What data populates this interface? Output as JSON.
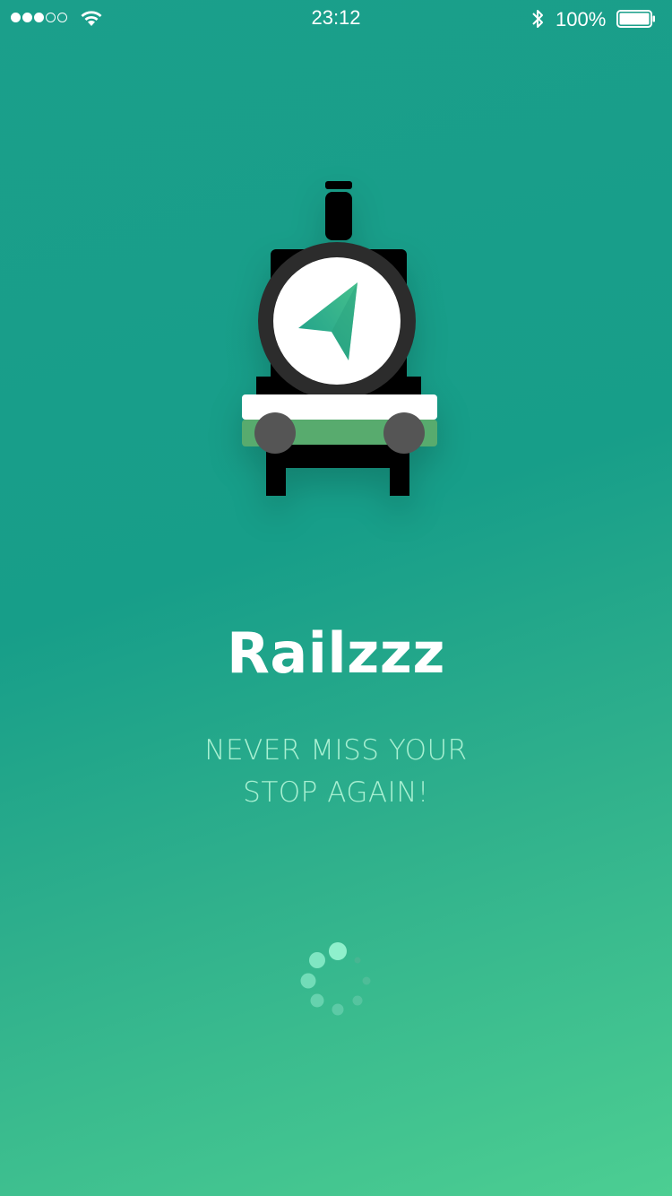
{
  "status_bar": {
    "time": "23:12",
    "battery_percent": "100%",
    "signal_bars_filled": 3,
    "signal_bars_total": 5,
    "icons": [
      "signal-dots-icon",
      "wifi-icon",
      "bluetooth-icon",
      "battery-icon"
    ]
  },
  "app": {
    "title": "Railzzz",
    "tagline_line1": "NEVER MISS YOUR",
    "tagline_line2": "STOP AGAIN!",
    "logo_icon": "train-locomotive-icon",
    "logo_inner_icon": "navigation-arrow-icon"
  },
  "loader": {
    "icon": "loading-spinner-icon"
  },
  "colors": {
    "background_top": "#179e89",
    "background_bottom": "#4cce92",
    "tagline": "#a8f0d2",
    "accent_green": "#58ab6e",
    "wheel": "#555555"
  }
}
